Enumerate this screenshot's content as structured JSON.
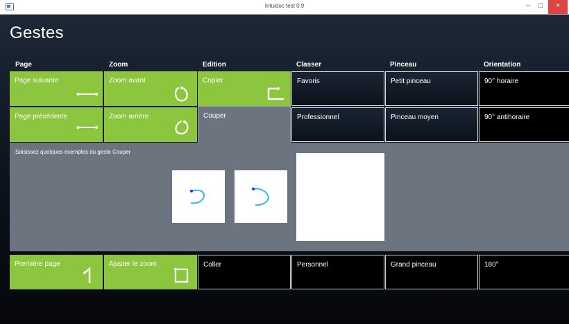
{
  "window": {
    "title": "Intuidoc test 0.9",
    "min_glyph": "–",
    "max_glyph": "□",
    "close_glyph": "×"
  },
  "page_title": "Gestes",
  "columns": [
    "Page",
    "Zoom",
    "Edition",
    "Classer",
    "Pinceau",
    "Orientation"
  ],
  "rows": [
    [
      "Page suivante",
      "Zoom avant",
      "Copier",
      "Favoris",
      "Petit pinceau",
      "90° horaire"
    ],
    [
      "Page précédente",
      "Zoom arrière",
      "Couper",
      "Professionnel",
      "Pinceau moyen",
      "90° antihoraire"
    ],
    [
      "Première page",
      "Ajuster le zoom",
      "Coller",
      "Personnel",
      "Grand pinceau",
      "180°"
    ]
  ],
  "selected_gesture": "Couper",
  "instruction": "Saisissez quelques exemples du geste Couper",
  "colors": {
    "green": "#8cc63f",
    "panel": "#6c7480",
    "stroke": "#38b6e8",
    "start_dot": "#1a2ed0"
  },
  "icons": {
    "page_suivante": "arrow-right-icon",
    "zoom_avant": "circle-clockwise-icon",
    "copier": "hook-stroke-icon",
    "page_precedente": "arrow-right-icon",
    "zoom_arriere": "circle-counterclockwise-icon",
    "premiere_page": "number-one-icon",
    "ajuster_le_zoom": "square-stroke-icon"
  }
}
